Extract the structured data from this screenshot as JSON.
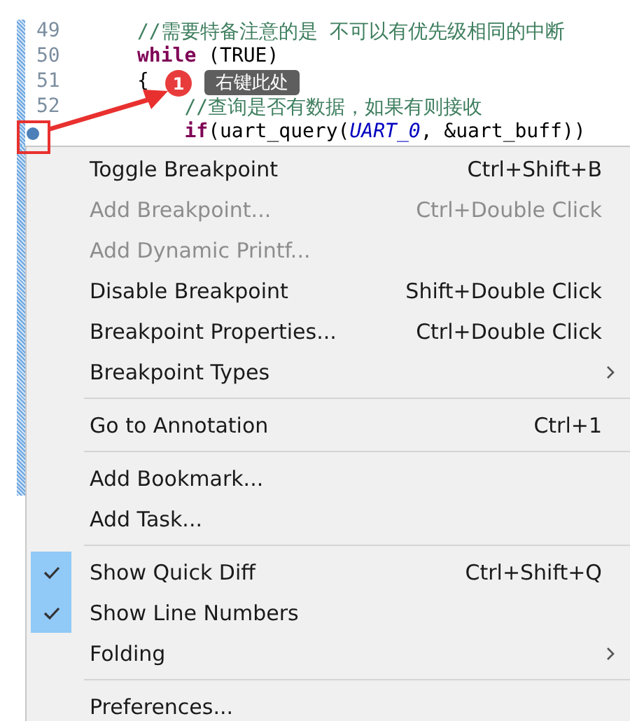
{
  "editor": {
    "lines": [
      {
        "number": "49",
        "tokens": [
          {
            "text": "//需要特备注意的是 不可以有优先级相同的中断",
            "kind": "comment"
          }
        ]
      },
      {
        "number": "50",
        "tokens": [
          {
            "text": "while",
            "kind": "keyword"
          },
          {
            "text": " (TRUE)",
            "kind": "plain"
          }
        ]
      },
      {
        "number": "51",
        "tokens": [
          {
            "text": "{",
            "kind": "plain"
          }
        ]
      },
      {
        "number": "52",
        "tokens": [
          {
            "text": "    //查询是否有数据，如果有则接收",
            "kind": "comment"
          }
        ]
      },
      {
        "marker": true,
        "tokens": [
          {
            "text": "    if",
            "kind": "keyword"
          },
          {
            "text": "(uart_query(",
            "kind": "plain"
          },
          {
            "text": "UART_0",
            "kind": "constant"
          },
          {
            "text": ", &uart_buff))",
            "kind": "plain"
          }
        ]
      }
    ]
  },
  "annotation": {
    "step": "1",
    "tooltip": "右键此处"
  },
  "menu": {
    "items": [
      {
        "kind": "item",
        "label": "Toggle Breakpoint",
        "shortcut": "Ctrl+Shift+B",
        "disabled": false,
        "checked": false,
        "submenu": false
      },
      {
        "kind": "item",
        "label": "Add Breakpoint...",
        "shortcut": "Ctrl+Double Click",
        "disabled": true,
        "checked": false,
        "submenu": false
      },
      {
        "kind": "item",
        "label": "Add Dynamic Printf...",
        "disabled": true,
        "checked": false,
        "submenu": false
      },
      {
        "kind": "item",
        "label": "Disable Breakpoint",
        "shortcut": "Shift+Double Click",
        "disabled": false,
        "checked": false,
        "submenu": false
      },
      {
        "kind": "item",
        "label": "Breakpoint Properties...",
        "shortcut": "Ctrl+Double Click",
        "disabled": false,
        "checked": false,
        "submenu": false
      },
      {
        "kind": "item",
        "label": "Breakpoint Types",
        "disabled": false,
        "checked": false,
        "submenu": true
      },
      {
        "kind": "separator"
      },
      {
        "kind": "item",
        "label": "Go to Annotation",
        "shortcut": "Ctrl+1",
        "disabled": false,
        "checked": false,
        "submenu": false
      },
      {
        "kind": "separator"
      },
      {
        "kind": "item",
        "label": "Add Bookmark...",
        "disabled": false,
        "checked": false,
        "submenu": false
      },
      {
        "kind": "item",
        "label": "Add Task...",
        "disabled": false,
        "checked": false,
        "submenu": false
      },
      {
        "kind": "separator"
      },
      {
        "kind": "item",
        "label": "Show Quick Diff",
        "shortcut": "Ctrl+Shift+Q",
        "disabled": false,
        "checked": true,
        "submenu": false
      },
      {
        "kind": "item",
        "label": "Show Line Numbers",
        "disabled": false,
        "checked": true,
        "submenu": false
      },
      {
        "kind": "item",
        "label": "Folding",
        "disabled": false,
        "checked": false,
        "submenu": true
      },
      {
        "kind": "separator"
      },
      {
        "kind": "item",
        "label": "Preferences...",
        "disabled": false,
        "checked": false,
        "submenu": false
      }
    ]
  }
}
